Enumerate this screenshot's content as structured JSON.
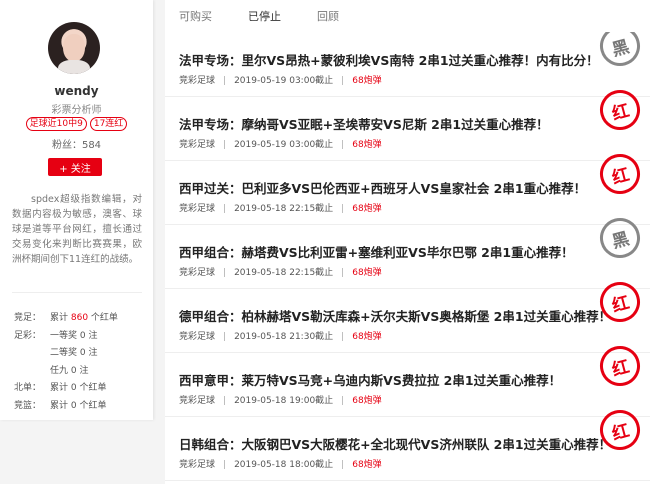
{
  "profile": {
    "username": "wendy",
    "subtitle": "彩票分析师",
    "badge_streak": "足球近10中9",
    "badge_red": "17连红",
    "fans": "粉丝：584",
    "follow_label": "+ 关注",
    "bio": "spdex超级指数编辑，对数据内容极为敏感，澳客、球球是道等平台网红，擅长通过交易变化来判断比赛赛果，欧洲杯期间创下11连红的战绩。",
    "stats": [
      {
        "label": "竞足：",
        "prefix": "累计 ",
        "value": "860",
        "suffix": " 个红单",
        "highlight": true
      },
      {
        "label": "足彩：",
        "prefix": "一等奖 0 注",
        "value": "",
        "suffix": "",
        "highlight": false
      },
      {
        "label": "",
        "prefix": "二等奖 0 注",
        "value": "",
        "suffix": "",
        "highlight": false
      },
      {
        "label": "",
        "prefix": "任九 0 注",
        "value": "",
        "suffix": "",
        "highlight": false
      },
      {
        "label": "北单：",
        "prefix": "累计 0 个红单",
        "value": "",
        "suffix": "",
        "highlight": false
      },
      {
        "label": "竞篮：",
        "prefix": "累计 0 个红单",
        "value": "",
        "suffix": "",
        "highlight": false
      }
    ]
  },
  "tabs": [
    "可购买",
    "已停止",
    "回顾"
  ],
  "active_tab": 1,
  "items": [
    {
      "title": "法甲专场：里尔VS昂热+蒙彼利埃VS南特 2串1过关重心推荐！内有比分！",
      "category": "竞彩足球",
      "time": "2019-05-19 03:00截止",
      "price": "68炮弹",
      "stamp": "黑",
      "stamp_color": "black"
    },
    {
      "title": "法甲专场：摩纳哥VS亚眠+圣埃蒂安VS尼斯 2串1过关重心推荐！",
      "category": "竞彩足球",
      "time": "2019-05-19 03:00截止",
      "price": "68炮弹",
      "stamp": "红",
      "stamp_color": "red"
    },
    {
      "title": "西甲过关：巴利亚多VS巴伦西亚+西班牙人VS皇家社会 2串1重心推荐！",
      "category": "竞彩足球",
      "time": "2019-05-18 22:15截止",
      "price": "68炮弹",
      "stamp": "红",
      "stamp_color": "red"
    },
    {
      "title": "西甲组合：赫塔费VS比利亚雷+塞维利亚VS毕尔巴鄂 2串1重心推荐！",
      "category": "竞彩足球",
      "time": "2019-05-18 22:15截止",
      "price": "68炮弹",
      "stamp": "黑",
      "stamp_color": "black"
    },
    {
      "title": "德甲组合：柏林赫塔VS勒沃库森+沃尔夫斯VS奥格斯堡 2串1过关重心推荐！",
      "category": "竞彩足球",
      "time": "2019-05-18 21:30截止",
      "price": "68炮弹",
      "stamp": "红",
      "stamp_color": "red"
    },
    {
      "title": "西甲意甲：莱万特VS马竞+乌迪内斯VS费拉拉 2串1过关重心推荐！",
      "category": "竞彩足球",
      "time": "2019-05-18 19:00截止",
      "price": "68炮弹",
      "stamp": "红",
      "stamp_color": "red"
    },
    {
      "title": "日韩组合：大阪钢巴VS大阪樱花+全北现代VS济州联队 2串1过关重心推荐！",
      "category": "竞彩足球",
      "time": "2019-05-18 18:00截止",
      "price": "68炮弹",
      "stamp": "红",
      "stamp_color": "red"
    }
  ]
}
